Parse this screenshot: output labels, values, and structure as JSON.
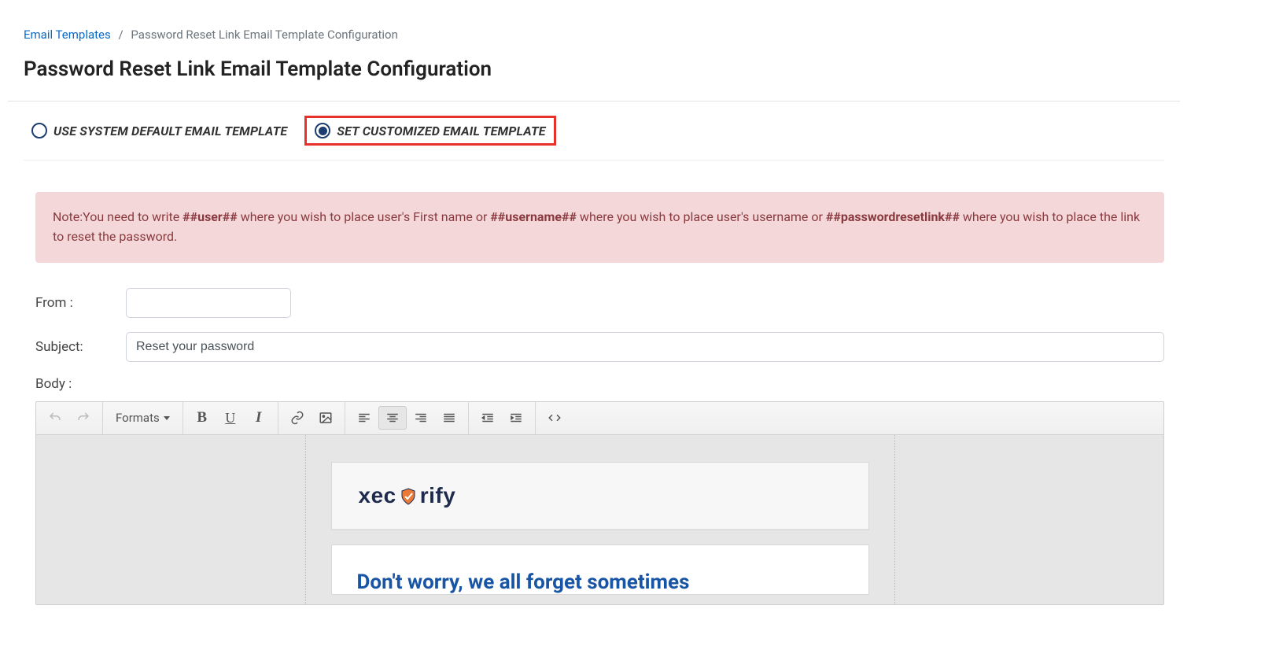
{
  "breadcrumb": {
    "link_label": "Email Templates",
    "current": "Password Reset Link Email Template Configuration"
  },
  "page_title": "Password Reset Link Email Template Configuration",
  "options": {
    "default_label": "USE SYSTEM DEFAULT EMAIL TEMPLATE",
    "custom_label": "SET CUSTOMIZED EMAIL TEMPLATE"
  },
  "note": {
    "prefix": "Note:",
    "seg1": "You need to write ",
    "token1": "##user##",
    "seg2": " where you wish to place user's First name or ",
    "token2": "##username##",
    "seg3": " where you wish to place user's username or ",
    "token3": "##passwordresetlink##",
    "seg4": " where you wish to place the link to reset the password."
  },
  "form": {
    "from_label": "From :",
    "from_value": "",
    "subject_label": "Subject:",
    "subject_value": "Reset your password",
    "body_label": "Body :"
  },
  "toolbar": {
    "formats_label": "Formats"
  },
  "email_preview": {
    "logo_left": "xec",
    "logo_right": "rify",
    "heading": "Don't worry, we all forget sometimes"
  }
}
